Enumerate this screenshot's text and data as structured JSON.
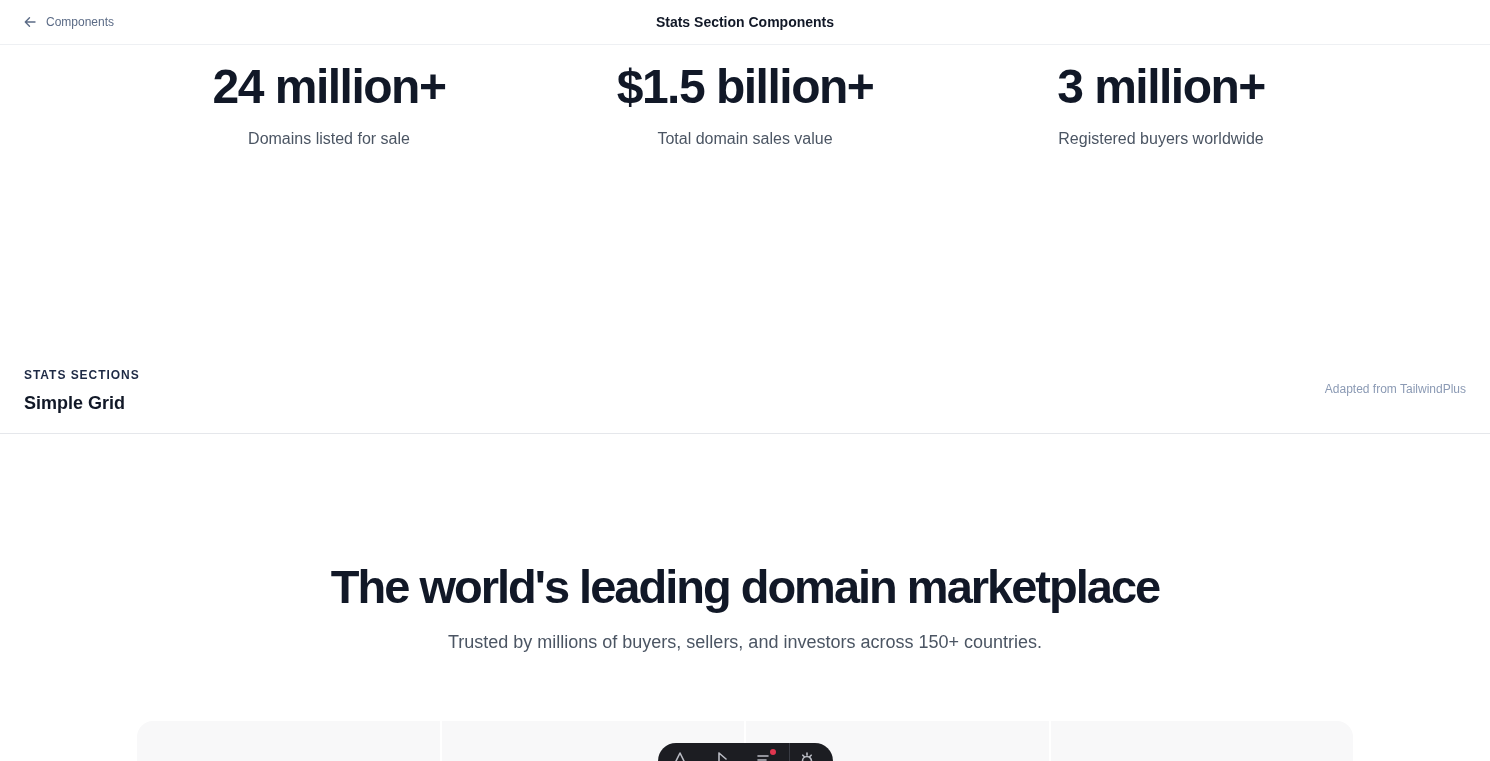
{
  "header": {
    "back_link": "Components",
    "title": "Stats Section Components"
  },
  "stats": [
    {
      "value": "24 million+",
      "label": "Domains listed for sale"
    },
    {
      "value": "$1.5 billion+",
      "label": "Total domain sales value"
    },
    {
      "value": "3 million+",
      "label": "Registered buyers worldwide"
    }
  ],
  "section": {
    "eyebrow": "STATS SECTIONS",
    "title": "Simple Grid",
    "credit": "Adapted from TailwindPlus"
  },
  "hero": {
    "heading": "The world's leading domain marketplace",
    "subheading": "Trusted by millions of buyers, sellers, and investors across 150+ countries."
  },
  "toolbar": {
    "has_notification": true
  }
}
